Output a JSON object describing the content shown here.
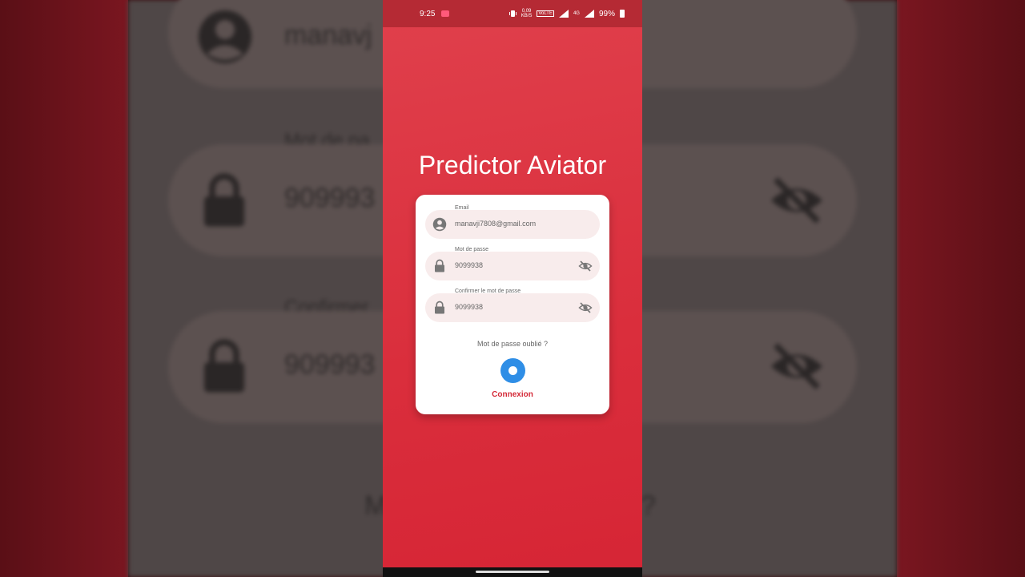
{
  "status_bar": {
    "time": "9:25",
    "speed": "0,09",
    "speed_unit": "KB/S",
    "network": "VoLTE",
    "signal": "4G",
    "battery": "99%"
  },
  "app": {
    "title": "Predictor Aviator"
  },
  "form": {
    "email_label": "Email",
    "email_value": "manavji7808@gmail.com",
    "password_label": "Mot de passe",
    "password_value": "9099938",
    "confirm_label": "Confirmer le mot de passe",
    "confirm_value": "9099938",
    "forgot_link": "Mot de passe oublié ?",
    "login_button": "Connexion"
  },
  "background": {
    "email_fragment": "manavj",
    "password_label_fragment": "Mot de pa",
    "password_fragment": "909993",
    "confirm_label_fragment": "Confirmer",
    "confirm_fragment": "909993",
    "forgot_fragment_left": "M",
    "forgot_fragment_right": "?"
  },
  "colors": {
    "primary": "#dc303e",
    "accent": "#2f8ee6",
    "field_bg": "#f8ecec"
  },
  "icons": [
    "account-icon",
    "lock-icon",
    "visibility-off-icon",
    "vibrate-icon",
    "signal-icon",
    "battery-icon"
  ]
}
